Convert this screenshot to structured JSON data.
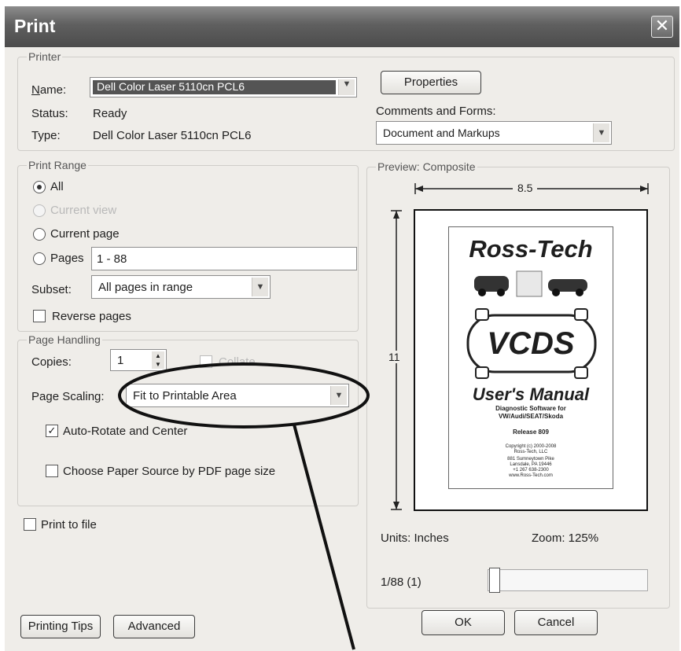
{
  "window": {
    "title": "Print",
    "close_icon": "close-icon"
  },
  "printer": {
    "legend": "Printer",
    "name_label": "Name:",
    "name_value": "Dell Color Laser 5110cn PCL6",
    "status_label": "Status:",
    "status_value": "Ready",
    "type_label": "Type:",
    "type_value": "Dell Color Laser 5110cn PCL6",
    "properties_label": "Properties",
    "comments_label": "Comments and Forms:",
    "comments_value": "Document and Markups"
  },
  "print_range": {
    "legend": "Print Range",
    "all_label": "All",
    "current_view_label": "Current view",
    "current_page_label": "Current page",
    "pages_label": "Pages",
    "pages_value": "1 - 88",
    "subset_label": "Subset:",
    "subset_value": "All pages in range",
    "reverse_label": "Reverse pages",
    "selected": "All"
  },
  "page_handling": {
    "legend": "Page Handling",
    "copies_label": "Copies:",
    "copies_value": "1",
    "collate_label": "Collate",
    "scaling_label": "Page Scaling:",
    "scaling_value": "Fit to Printable Area",
    "auto_rotate_label": "Auto-Rotate and Center",
    "auto_rotate_checked": true,
    "paper_source_label": "Choose Paper Source by PDF page size",
    "paper_source_checked": false
  },
  "print_to_file": {
    "label": "Print to file",
    "checked": false
  },
  "preview": {
    "legend": "Preview: Composite",
    "width_label": "8.5",
    "height_label": "11",
    "units_text": "Units: Inches",
    "zoom_text": "Zoom: 125%",
    "page_text": "1/88 (1)",
    "doc": {
      "brand": "Ross-Tech",
      "logo": "VCDS",
      "manual_title": "User's Manual",
      "subtitle_lines": [
        "Diagnostic Software for",
        "VW/Audi/SEAT/Skoda"
      ],
      "release": "Release 809",
      "address_lines": [
        "Copyright (c) 2000-2008",
        "Ross-Tech, LLC",
        "881 Sumneytown Pike",
        "Lansdale, PA 19446",
        "+1 267 638-2300",
        "www.Ross-Tech.com"
      ]
    }
  },
  "buttons": {
    "printing_tips": "Printing Tips",
    "advanced": "Advanced",
    "ok": "OK",
    "cancel": "Cancel"
  },
  "annotation": {
    "color": "#111111"
  }
}
